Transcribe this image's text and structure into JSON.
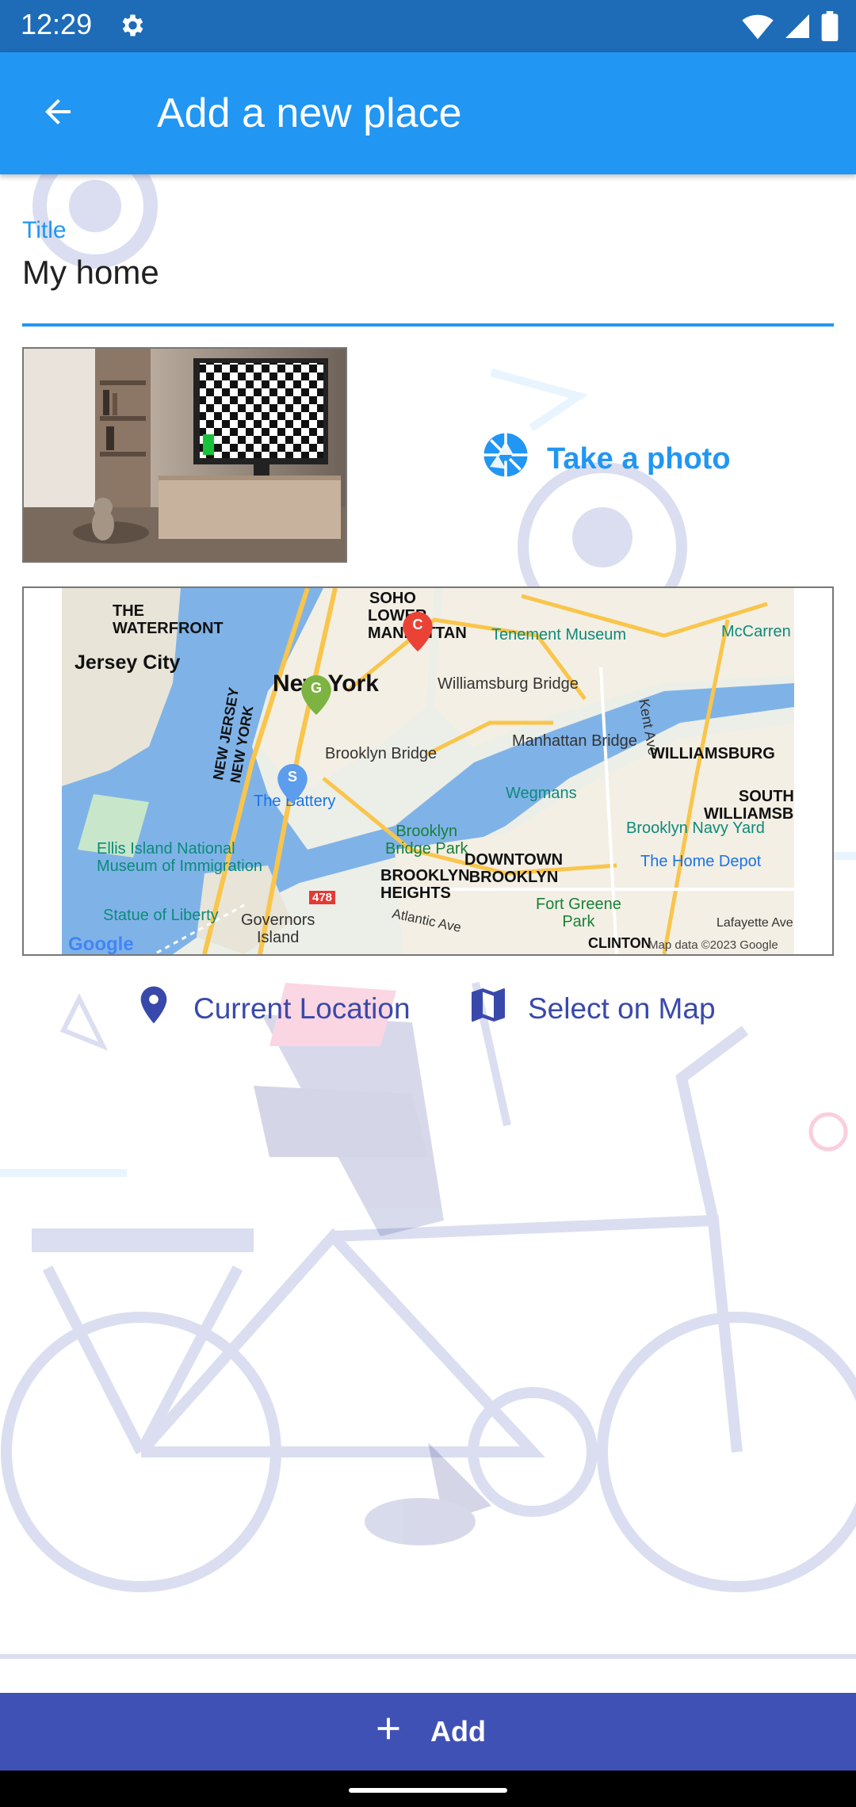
{
  "status_bar": {
    "time": "12:29"
  },
  "app_bar": {
    "title": "Add a new place"
  },
  "form": {
    "title_label": "Title",
    "title_value": "My home",
    "take_photo_label": "Take a photo"
  },
  "map": {
    "labels": {
      "soho": "SOHO",
      "the_waterfront": "THE\nWATERFRONT",
      "lower_manhattan": "LOWER MANHATTAN",
      "tenement_museum": "Tenement Museum",
      "mccarren_park": "McCarren Park",
      "jersey_city": "Jersey City",
      "new_york": "New York",
      "williamsburg_bridge": "Williamsburg Bridge",
      "new_jersey_new_york": "NEW JERSEY\nNEW YORK",
      "kent_ave": "Kent Ave",
      "brooklyn_bridge": "Brooklyn Bridge",
      "manhattan_bridge": "Manhattan Bridge",
      "williamsburg": "WILLIAMSBURG",
      "the_battery": "The Battery",
      "wegmans": "Wegmans",
      "south_williamsburg": "SOUTH\nWILLIAMSBURG",
      "brooklyn_bridge_park": "Brooklyn\nBridge Park",
      "brooklyn_navy_yard": "Brooklyn Navy Yard",
      "ellis_island": "Ellis Island National\nMuseum of Immigration",
      "downtown_brooklyn": "DOWNTOWN\nBROOKLYN",
      "brooklyn_heights": "BROOKLYN\nHEIGHTS",
      "home_depot": "The Home Depot",
      "highway_478": "478",
      "statue_of_liberty": "Statue of Liberty",
      "governors_island": "Governors\nIsland",
      "atlantic_ave": "Atlantic Ave",
      "fort_greene_park": "Fort Greene\nPark",
      "lafayette_ave": "Lafayette Ave",
      "clinton": "CLINTON",
      "google": "Google",
      "map_data": "Map data ©2023 Google",
      "marker_c": "C",
      "marker_g": "G",
      "marker_s": "S"
    }
  },
  "location_buttons": {
    "current_location": "Current Location",
    "select_on_map": "Select on Map"
  },
  "add_button": {
    "label": "Add"
  },
  "colors": {
    "app_bar": "#2196f3",
    "status_bar": "#1e6bb8",
    "accent": "#2196f3",
    "indigo": "#3f51b5",
    "location_text": "#3949ab"
  },
  "icons": {
    "back": "arrow-left-icon",
    "settings": "gear-icon",
    "wifi": "wifi-icon",
    "signal": "signal-icon",
    "battery": "battery-icon",
    "camera": "camera-aperture-icon",
    "location": "map-pin-icon",
    "map": "map-icon",
    "add": "plus-icon"
  }
}
